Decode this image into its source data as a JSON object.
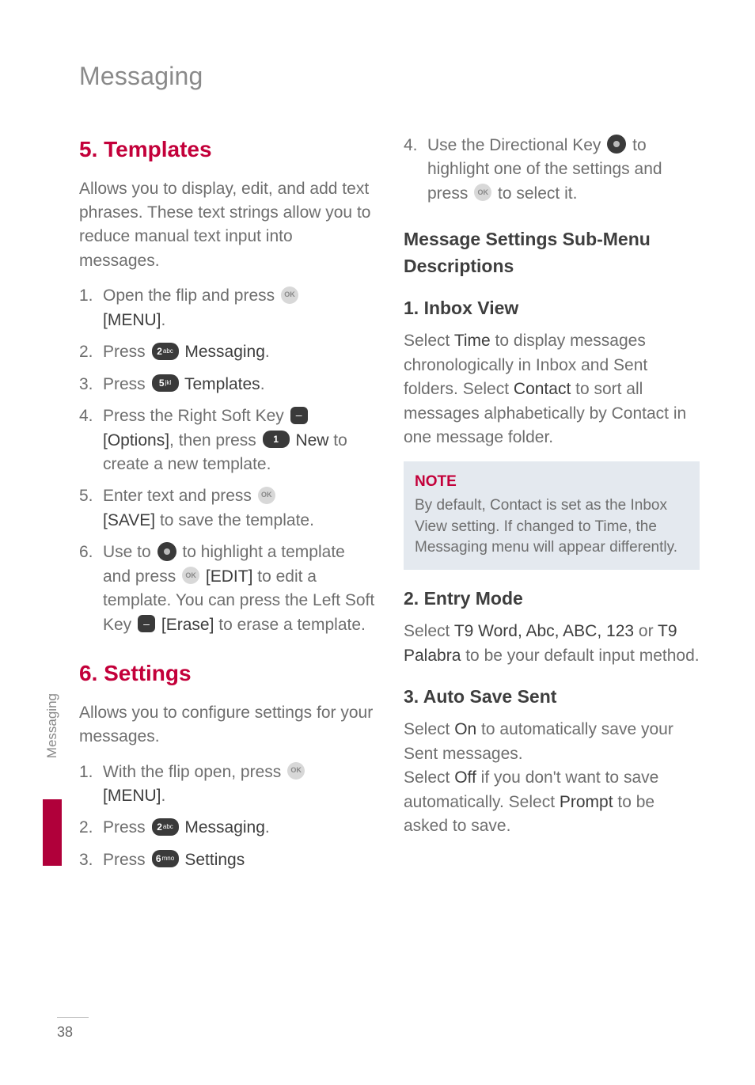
{
  "page_title": "Messaging",
  "side_tab": "Messaging",
  "page_number": "38",
  "left": {
    "section5_title": "5. Templates",
    "section5_intro": "Allows you to display, edit, and add text phrases. These text strings allow you to reduce manual text input into messages.",
    "s5_1a": "Open the flip and press ",
    "s5_1b": "[MENU]",
    "s5_1c": ".",
    "s5_2a": "Press ",
    "s5_2b": " Messaging",
    "s5_2c": ".",
    "s5_3a": "Press ",
    "s5_3b": " Templates",
    "s5_3c": ".",
    "s5_4a": "Press the Right Soft Key ",
    "s5_4b": "[Options]",
    "s5_4c": ", then press ",
    "s5_4d": "New",
    "s5_4e": " to create a new template.",
    "s5_5a": "Enter text and press ",
    "s5_5b": "[SAVE]",
    "s5_5c": " to save the template.",
    "s5_6a": "Use to ",
    "s5_6b": " to highlight a template and press ",
    "s5_6c": " [EDIT]",
    "s5_6d": " to edit a template. You can press the Left Soft Key ",
    "s5_6e": "[Erase]",
    "s5_6f": " to erase a template.",
    "section6_title": "6. Settings",
    "section6_intro": "Allows you to configure settings for your messages.",
    "s6_1a": "With the flip open, press ",
    "s6_1b": "[MENU]",
    "s6_1c": ".",
    "s6_2a": "Press ",
    "s6_2b": " Messaging",
    "s6_2c": ".",
    "s6_3a": "Press ",
    "s6_3b": " Settings"
  },
  "right": {
    "s4a": "Use the Directional Key ",
    "s4b": " to highlight one of the settings and press ",
    "s4c": " to select it.",
    "sub_heading": "Message Settings Sub-Menu Descriptions",
    "h1": "1. Inbox View",
    "p1a": "Select ",
    "p1b": "Time",
    "p1c": " to display messages chronologically in Inbox and Sent folders. Select ",
    "p1d": "Contact",
    "p1e": " to sort all messages alphabetically by Contact in one message folder.",
    "note_title": "NOTE",
    "note_body": "By default, Contact is set as the Inbox View setting. If changed to Time, the Messaging menu will appear differently.",
    "h2": "2. Entry Mode",
    "p2a": "Select ",
    "p2b": "T9 Word, Abc, ABC, 123",
    "p2c": " or ",
    "p2d": "T9 Palabra",
    "p2e": " to be your default input method.",
    "h3": "3. Auto Save Sent",
    "p3a": "Select ",
    "p3b": "On",
    "p3c": " to automatically save your Sent messages.",
    "p3d": "Select ",
    "p3e": "Off",
    "p3f": " if you don't want to save automatically. Select ",
    "p3g": "Prompt",
    "p3h": " to be asked to save."
  },
  "keys": {
    "ok": "OK",
    "k1": "1",
    "k2": "2",
    "k5": "5",
    "k6": "6",
    "abc": "abc",
    "jkl": "jkl",
    "mno": "mno",
    "minus": "–"
  }
}
